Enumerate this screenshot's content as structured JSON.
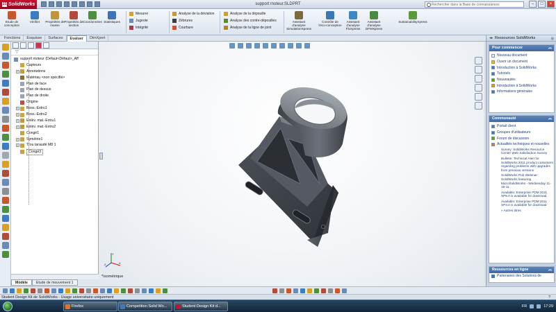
{
  "app": {
    "logo_text": "SolidWorks",
    "document_title": "support moteur.SLDPRT",
    "search_placeholder": "Rechercher dans la Base de connaissances",
    "window_controls": [
      "minimize-icon",
      "restore-icon",
      "close-icon"
    ]
  },
  "ribbon": {
    "large_buttons": [
      {
        "label": "Etude de conception",
        "icon": "design-study-icon",
        "color": "#c8572a"
      },
      {
        "label": "Vérifier",
        "icon": "check-icon",
        "color": "#3e7cc2"
      },
      {
        "label": "Propriétés de masse",
        "icon": "mass-properties-icon",
        "color": "#c0953c"
      },
      {
        "label": "Propriétés de section",
        "icon": "section-properties-icon",
        "color": "#b24b3a"
      },
      {
        "label": "Coordonnées",
        "icon": "coordinates-icon",
        "color": "#4d8f3e"
      },
      {
        "label": "Statistiques",
        "icon": "statistics-icon",
        "color": "#3f73b5"
      }
    ],
    "small_buttons_col1": [
      {
        "label": "Mesurer",
        "icon": "measure-icon",
        "color": "#d9a026"
      },
      {
        "label": "Jugeote",
        "icon": "sense-icon",
        "color": "#6a8ab8"
      },
      {
        "label": "Intégrité",
        "icon": "integrity-icon",
        "color": "#a23b49"
      }
    ],
    "small_buttons_col2": [
      {
        "label": "Analyse de la déviation",
        "icon": "deviation-icon",
        "color": "#c89a2a"
      },
      {
        "label": "Zébrures",
        "icon": "zebra-icon",
        "color": "#3c3c3c"
      },
      {
        "label": "Courbure",
        "icon": "curvature-icon",
        "color": "#d84e2c"
      }
    ],
    "small_buttons_col3": [
      {
        "label": "Analyse de la dépouille",
        "icon": "draft-analysis-icon",
        "color": "#c7a233"
      },
      {
        "label": "Analyse des contre-dépouilles",
        "icon": "undercut-icon",
        "color": "#5d8a3a"
      },
      {
        "label": "Analyse de la ligne de joint",
        "icon": "parting-line-icon",
        "color": "#b6822a"
      }
    ],
    "analysis_buttons": [
      {
        "label": "Assistant d'analyse SimulationXpress",
        "icon": "simulationxpress-icon",
        "color": "#7a6a3d"
      },
      {
        "label": "Contrôle de l'éco-conception",
        "icon": "eco-icon",
        "color": "#3a78b5"
      },
      {
        "label": "Assistant d'analyse FloXpress",
        "icon": "floxpress-icon",
        "color": "#3e86c5"
      },
      {
        "label": "Assistant d'analyse DFMXpress",
        "icon": "dfmxpress-icon",
        "color": "#4c8a44"
      },
      {
        "label": "SustainabilityXpress",
        "icon": "sustainability-icon",
        "color": "#5a9a3a"
      }
    ]
  },
  "command_tabs": [
    {
      "label": "Fonctions",
      "active": false
    },
    {
      "label": "Esquisse",
      "active": false
    },
    {
      "label": "Surfaces",
      "active": false
    },
    {
      "label": "Evaluer",
      "active": true
    },
    {
      "label": "DimXpert",
      "active": false
    }
  ],
  "feature_tree": {
    "filter_icon": "filter-icon",
    "nodes": [
      {
        "label": "support moteur (Défaut<Défaut>_Aff",
        "indent": 0,
        "expand": "",
        "icon": "part-icon",
        "color": "#6f8fb5"
      },
      {
        "label": "Capteurs",
        "indent": 1,
        "expand": "",
        "icon": "sensor-folder-icon",
        "color": "#d4a43a"
      },
      {
        "label": "Annotations",
        "indent": 1,
        "expand": "+",
        "icon": "annotations-icon",
        "color": "#c99a34"
      },
      {
        "label": "Matériau <non spécifié>",
        "indent": 1,
        "expand": "",
        "icon": "material-icon",
        "color": "#8b6d3f"
      },
      {
        "label": "Plan de face",
        "indent": 1,
        "expand": "",
        "icon": "plane-icon",
        "color": "#9aa4b1"
      },
      {
        "label": "Plan de dessus",
        "indent": 1,
        "expand": "",
        "icon": "plane-icon",
        "color": "#9aa4b1"
      },
      {
        "label": "Plan de droite",
        "indent": 1,
        "expand": "",
        "icon": "plane-icon",
        "color": "#9aa4b1"
      },
      {
        "label": "Origine",
        "indent": 1,
        "expand": "",
        "icon": "origin-icon",
        "color": "#c24a3e"
      },
      {
        "label": "Boss.-Extru1",
        "indent": 1,
        "expand": "+",
        "icon": "extrude-icon",
        "color": "#d1a43d"
      },
      {
        "label": "Boss.-Extru2",
        "indent": 1,
        "expand": "+",
        "icon": "extrude-icon",
        "color": "#d1a43d"
      },
      {
        "label": "Enlèv. mat.-Extru1",
        "indent": 1,
        "expand": "+",
        "icon": "cut-extrude-icon",
        "color": "#c4973c"
      },
      {
        "label": "Enlèv. mat.-Extru2",
        "indent": 1,
        "expand": "+",
        "icon": "cut-extrude-icon",
        "color": "#c4973c"
      },
      {
        "label": "Congé1",
        "indent": 1,
        "expand": "",
        "icon": "fillet-icon",
        "color": "#c9a342"
      },
      {
        "label": "Symétrie1",
        "indent": 1,
        "expand": "+",
        "icon": "mirror-icon",
        "color": "#c9a342"
      },
      {
        "label": "Trou taraudé M8 1",
        "indent": 1,
        "expand": "+",
        "icon": "hole-wizard-icon",
        "color": "#c9a342"
      },
      {
        "label": "Congé3",
        "indent": 1,
        "expand": "",
        "icon": "fillet-icon",
        "color": "#c9a342",
        "selected": true
      }
    ]
  },
  "model_tabs": [
    {
      "label": "Modèle",
      "active": true
    },
    {
      "label": "Etude de mouvement 1",
      "active": false
    }
  ],
  "graphics": {
    "view_label": "*Isométrique",
    "part_color": "#5c6169"
  },
  "task_pane": {
    "header": "Ressources SolidWorks",
    "getting_started": {
      "title": "Pour commencer",
      "links": [
        {
          "label": "Nouveau document",
          "icon": "new-document-icon",
          "color": "#e8e8e8"
        },
        {
          "label": "Ouvrir un document",
          "icon": "open-document-icon",
          "color": "#e4b23a"
        },
        {
          "label": "Introduction à SolidWorks",
          "icon": "introduction-icon",
          "color": "#3c79c0"
        },
        {
          "label": "Tutoriels",
          "icon": "tutorials-icon",
          "color": "#3c79c0"
        },
        {
          "label": "Nouveautés",
          "icon": "whats-new-icon",
          "color": "#5a9a3a"
        },
        {
          "label": "Introduction à SolidWorks",
          "icon": "introduction-icon",
          "color": "#d9a026"
        },
        {
          "label": "Informations générales",
          "icon": "information-icon",
          "color": "#3c79c0"
        }
      ]
    },
    "community": {
      "title": "Communauté",
      "links": [
        {
          "label": "Portail client",
          "icon": "customer-portal-icon",
          "color": "#3c79c0"
        },
        {
          "label": "Groupes d'utilisateurs",
          "icon": "user-groups-icon",
          "color": "#3c79c0"
        },
        {
          "label": "Forum de discussion",
          "icon": "discussion-forum-icon",
          "color": "#5a9a3a"
        },
        {
          "label": "Actualités techniques et nouvelles",
          "icon": "rss-icon",
          "color": "#e0742a"
        }
      ],
      "feed": [
        {
          "title": "Survey: SolidWorks Resource Center Web Satisfaction Survey",
          "date": ""
        },
        {
          "title": "Bulletin: Technical Alert for SolidWorks 2011 product customers regarding problems with upgrades from previous versions",
          "date": ""
        },
        {
          "title": "SolidWorks Pub Webinar: SolidWorks featuring MicroSolidWorks - Wednesday 11-16-11",
          "date": ""
        },
        {
          "title": "Available: Enterprise PDM 2011 SP5.0 is available for download",
          "date": ""
        },
        {
          "title": "Available: Enterprise PDM 2011 SP4.0 is available for download",
          "date": ""
        }
      ],
      "more_label": "» Autres titres"
    },
    "online_resources": {
      "title": "Ressources en ligne",
      "link": "Partenaires des Solutions de"
    }
  },
  "status_bar": {
    "text": "Student Design Kit de SolidWorks - Usage universitaire uniquement",
    "right": "?"
  },
  "taskbar": {
    "items": [
      {
        "label": "Firefox",
        "icon": "firefox-icon",
        "color": "#e0742a"
      },
      {
        "label": "Competition Solid Wo...",
        "icon": "browser-icon",
        "color": "#3c79c0"
      },
      {
        "label": "Student Design Kit d...",
        "icon": "solidworks-icon",
        "color": "#c8102e"
      }
    ],
    "tray_lang": "FR",
    "clock": "17:29"
  }
}
